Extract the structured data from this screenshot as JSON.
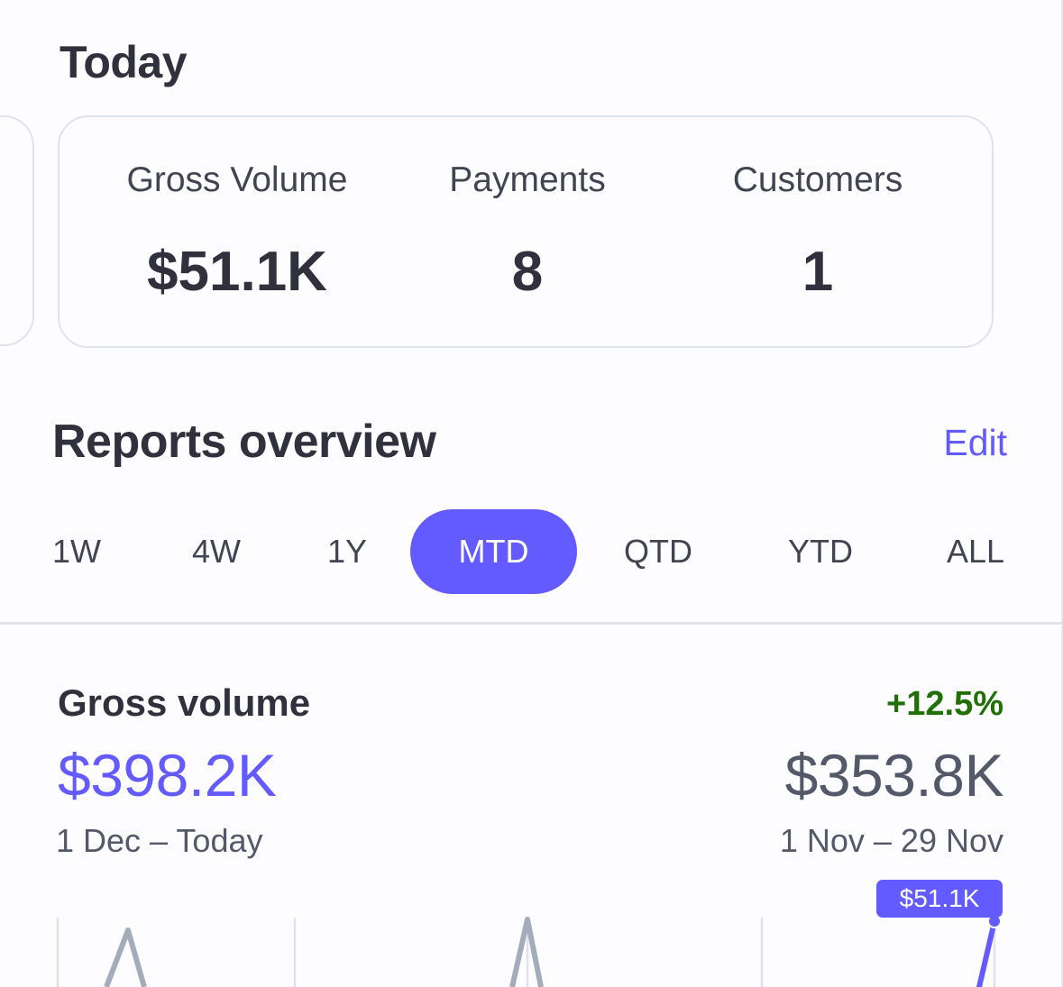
{
  "today": {
    "title": "Today",
    "metrics": [
      {
        "label": "Gross Volume",
        "value": "$51.1K"
      },
      {
        "label": "Payments",
        "value": "8"
      },
      {
        "label": "Customers",
        "value": "1"
      }
    ]
  },
  "reports": {
    "title": "Reports overview",
    "edit_label": "Edit",
    "periods": [
      "1W",
      "4W",
      "1Y",
      "MTD",
      "QTD",
      "YTD",
      "ALL"
    ],
    "active_period": "MTD"
  },
  "gross_volume": {
    "title": "Gross volume",
    "change": "+12.5%",
    "current_value": "$398.2K",
    "current_range": "1 Dec – Today",
    "previous_value": "$353.8K",
    "previous_range": "1 Nov – 29 Nov",
    "tooltip_value": "$51.1K"
  },
  "colors": {
    "accent": "#635bff",
    "positive": "#217005",
    "previous_series": "#a3acba",
    "text": "#30313d"
  }
}
